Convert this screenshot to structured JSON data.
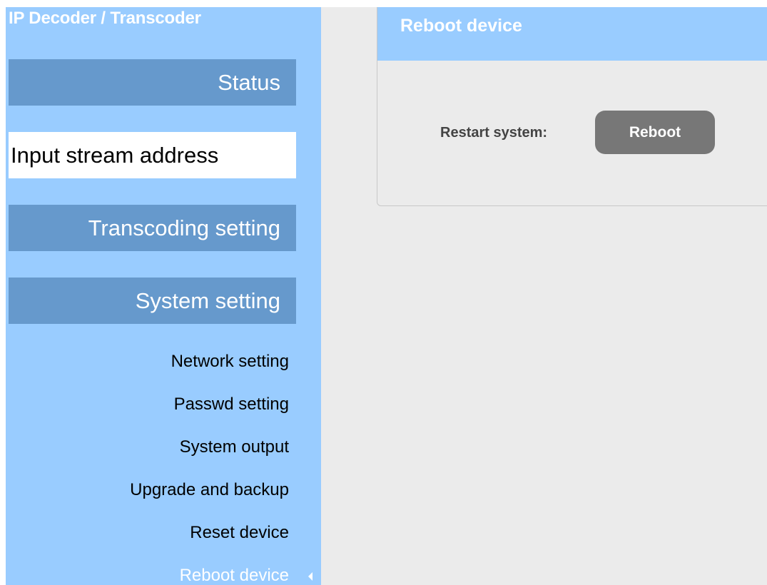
{
  "app": {
    "title": "IP Decoder / Transcoder"
  },
  "sidebar": {
    "nav": [
      {
        "label": "Status",
        "active": false
      },
      {
        "label": "Input stream address",
        "active": true
      },
      {
        "label": "Transcoding setting",
        "active": false
      },
      {
        "label": "System setting",
        "active": false
      }
    ],
    "system_submenu": [
      {
        "label": "Network setting"
      },
      {
        "label": "Passwd setting"
      },
      {
        "label": "System output"
      },
      {
        "label": "Upgrade and backup"
      },
      {
        "label": "Reset device"
      },
      {
        "label": "Reboot device",
        "current": true,
        "icon": "caret-left-icon"
      }
    ]
  },
  "panel": {
    "title": "Reboot device",
    "restart_label": "Restart system:",
    "reboot_button": "Reboot"
  },
  "colors": {
    "sidebar_bg": "#99ccff",
    "nav_block_bg": "#6699cc",
    "main_bg": "#ebebeb",
    "button_bg": "#777777"
  }
}
